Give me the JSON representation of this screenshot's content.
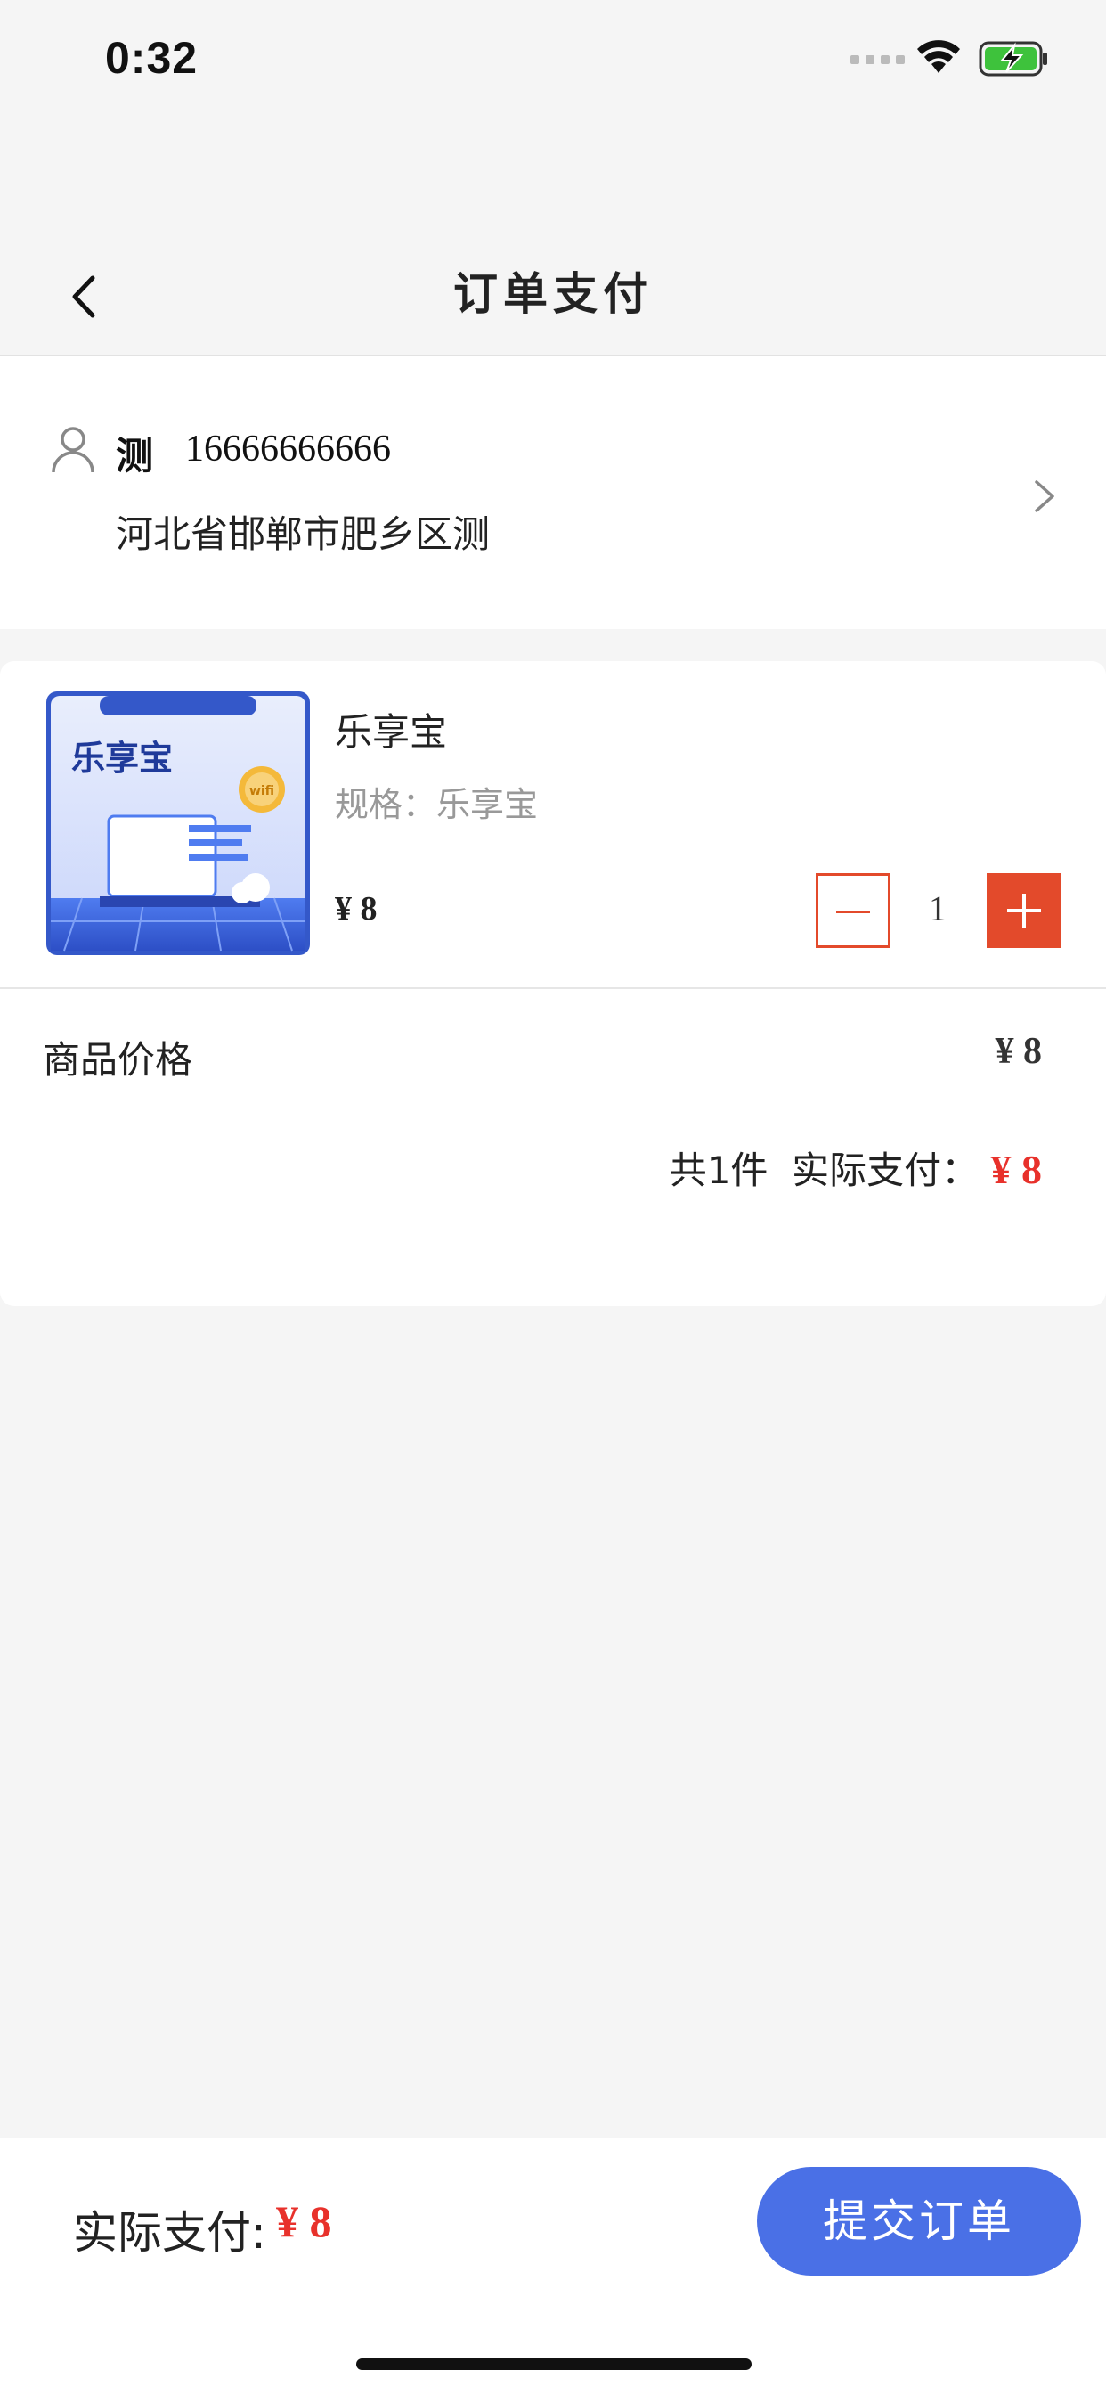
{
  "status_bar": {
    "time": "0:32"
  },
  "nav": {
    "title": "订单支付"
  },
  "address": {
    "name": "测",
    "phone": "16666666666",
    "detail": "河北省邯郸市肥乡区测"
  },
  "product": {
    "name": "乐享宝",
    "spec": "规格：乐享宝",
    "price": "¥ 8",
    "quantity": "1",
    "image_text": "乐享宝",
    "image_badge": "wifi"
  },
  "price_row": {
    "label": "商品价格",
    "value": "¥ 8"
  },
  "summary": {
    "count": "共1件",
    "pay_label": "实际支付：",
    "pay_value": "¥ 8"
  },
  "bottom": {
    "pay_label": "实际支付:",
    "pay_value": "¥ 8",
    "submit_label": "提交订单"
  },
  "colors": {
    "accent_red": "#e8312b",
    "button_red": "#e34a2b",
    "submit_blue": "#4a70e6"
  }
}
